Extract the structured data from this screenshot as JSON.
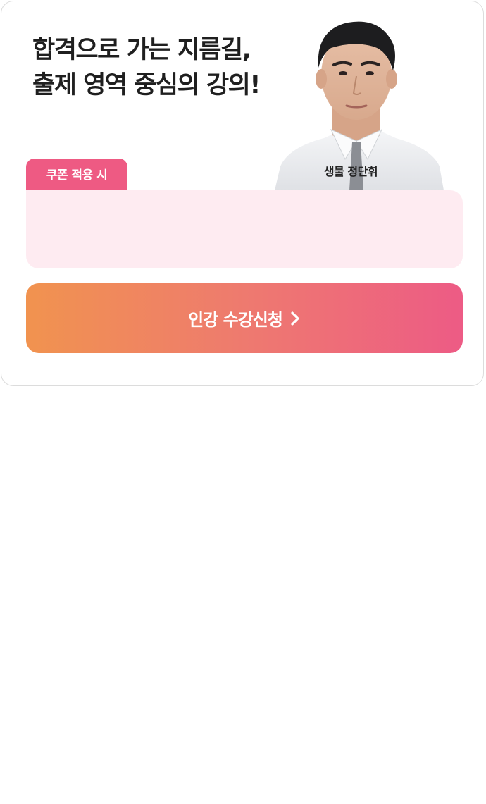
{
  "headline": {
    "line1": "합격으로 가는 지름길,",
    "line2": "출제 영역 중심의 강의!"
  },
  "teacher": {
    "caption": "생물 정단휘"
  },
  "coupon": {
    "tab_label": "쿠폰 적용 시"
  },
  "cta": {
    "label": "인강 수강신청",
    "icon": "chevron-right-icon"
  },
  "colors": {
    "coupon_tab": "#ee5a83",
    "coupon_panel": "#feebf1",
    "cta_gradient_start": "#f1934f",
    "cta_gradient_end": "#ed5b85",
    "headline_text": "#1f1f1f"
  }
}
